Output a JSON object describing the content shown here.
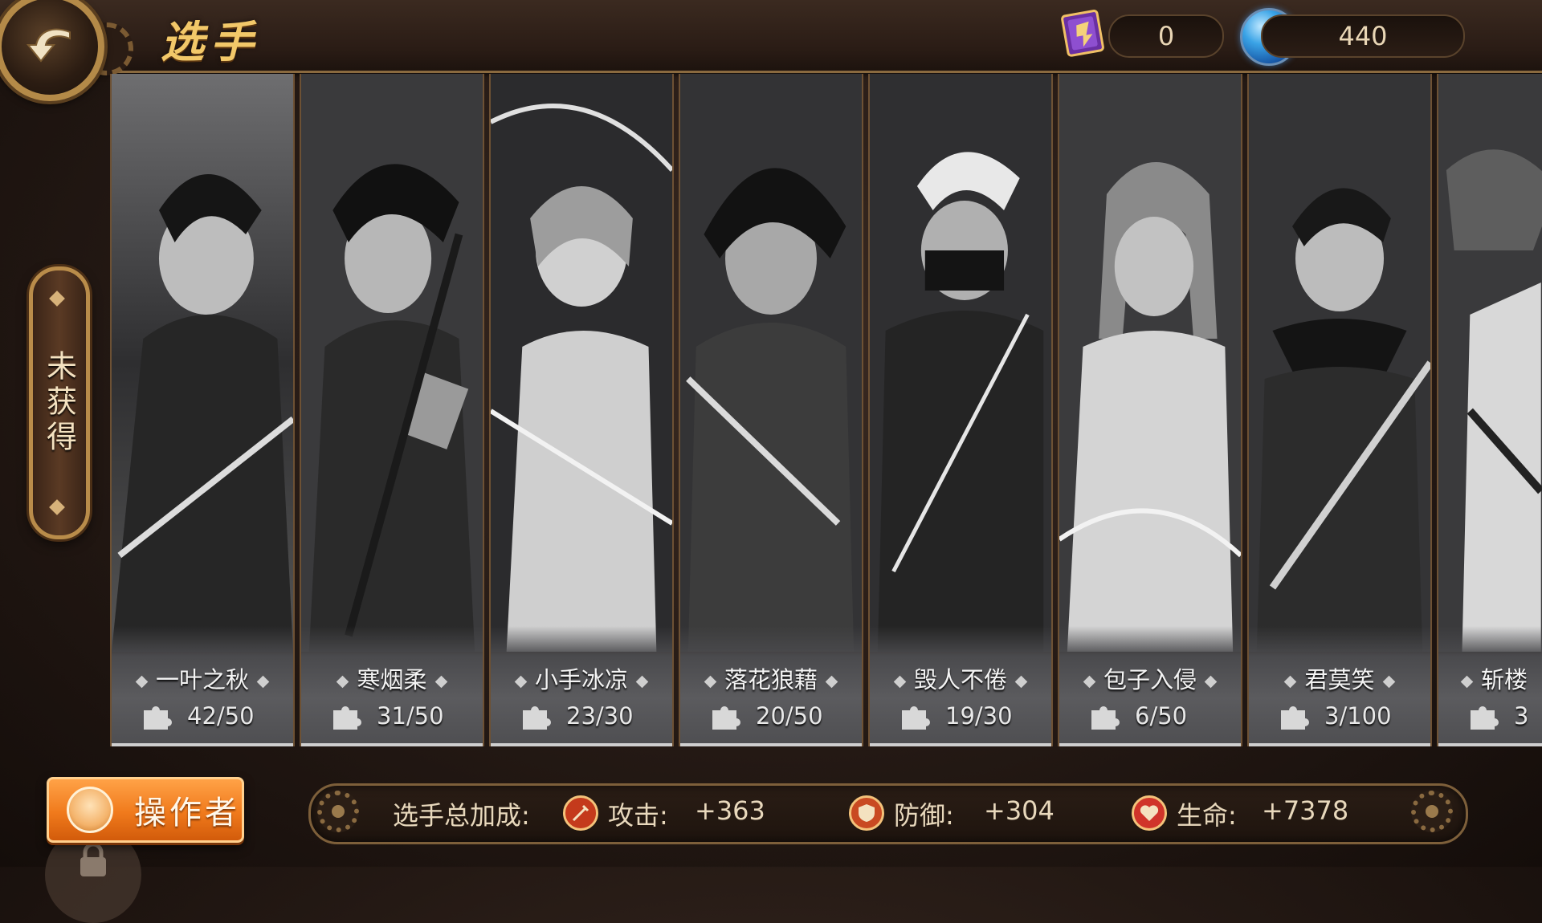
{
  "header": {
    "title": "选手",
    "book_count": "0",
    "orb_count": "440"
  },
  "side_tab": {
    "label": "未获得"
  },
  "cards": [
    {
      "name": "一叶之秋",
      "fragments": "42/50"
    },
    {
      "name": "寒烟柔",
      "fragments": "31/50"
    },
    {
      "name": "小手冰凉",
      "fragments": "23/30"
    },
    {
      "name": "落花狼藉",
      "fragments": "20/50"
    },
    {
      "name": "毁人不倦",
      "fragments": "19/30"
    },
    {
      "name": "包子入侵",
      "fragments": "6/50"
    },
    {
      "name": "君莫笑",
      "fragments": "3/100"
    },
    {
      "name": "斩楼",
      "fragments": "3"
    }
  ],
  "footer": {
    "operator_label": "操作者",
    "bonus_label": "选手总加成:",
    "attack_label": "攻击:",
    "attack_value": "+363",
    "defense_label": "防御:",
    "defense_value": "+304",
    "hp_label": "生命:",
    "hp_value": "+7378"
  },
  "icons": [
    "back-arrow-icon",
    "book-icon",
    "orb-icon",
    "puzzle-icon",
    "sword-icon",
    "shield-icon",
    "heart-icon",
    "gear-icon",
    "lock-icon",
    "operator-avatar-icon"
  ],
  "colors": {
    "title_gold": "#f2c869",
    "operator_orange": "#f07a1c",
    "frame_gold": "#b98c4a"
  }
}
